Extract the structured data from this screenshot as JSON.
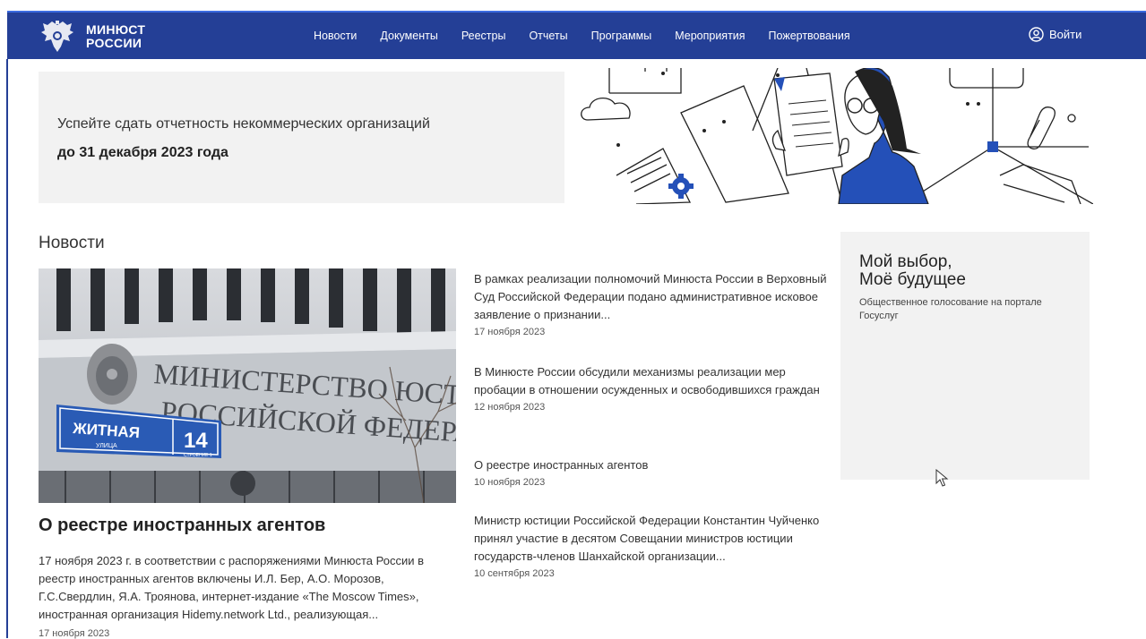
{
  "header": {
    "brand_line1": "МИНЮСТ",
    "brand_line2": "РОССИИ",
    "nav": [
      "Новости",
      "Документы",
      "Реестры",
      "Отчеты",
      "Программы",
      "Мероприятия",
      "Пожертвования"
    ],
    "login_label": "Войти",
    "login_icon": "user-circle-icon",
    "bg_color": "#243f96"
  },
  "banner": {
    "line1": "Успейте сдать отчетность некоммерческих организаций",
    "line2": "до 31 декабря 2023 года",
    "accent_color": "#2450b8"
  },
  "news": {
    "section_title": "Новости",
    "photo_sign_line1": "МИНИСТЕРСТВО ЮСТИЦИИ",
    "photo_sign_line2": "РОССИЙСКОЙ ФЕДЕРАЦИИ",
    "photo_street": "ЖИТНАЯ",
    "photo_street_sub": "УЛИЦА",
    "photo_house": "14",
    "photo_house_sub": "СТРОЕНИЕ 1",
    "main": {
      "headline": "О реестре иностранных агентов",
      "text": "17 ноября 2023 г. в соответствии с распоряжениями Минюста России в реестр иностранных агентов включены И.Л. Бер, А.О. Морозов, Г.С.Свердлин, Я.А. Троянова, интернет-издание «The Moscow Times», иностранная организация Hidemy.network Ltd., реализующая...",
      "date": "17 ноября 2023"
    },
    "items": [
      {
        "title": "В рамках реализации полномочий Минюста России в Верховный Суд Российской Федерации подано административное исковое заявление о признании...",
        "date": "17 ноября 2023"
      },
      {
        "title": "В Минюсте России обсудили механизмы реализации мер пробации в отношении осужденных и освободившихся граждан",
        "date": "12 ноября 2023"
      },
      {
        "title": "О реестре иностранных агентов",
        "date": "10 ноября 2023"
      },
      {
        "title": "Министр юстиции Российской Федерации Константин Чуйченко принял участие в десятом Совещании министров юстиции государств-членов Шанхайской организации...",
        "date": "10 сентября 2023"
      }
    ]
  },
  "promo": {
    "title_line1": "Мой выбор,",
    "title_line2": "Моё будущее",
    "subtitle": "Общественное голосование на портале Госуслуг"
  }
}
